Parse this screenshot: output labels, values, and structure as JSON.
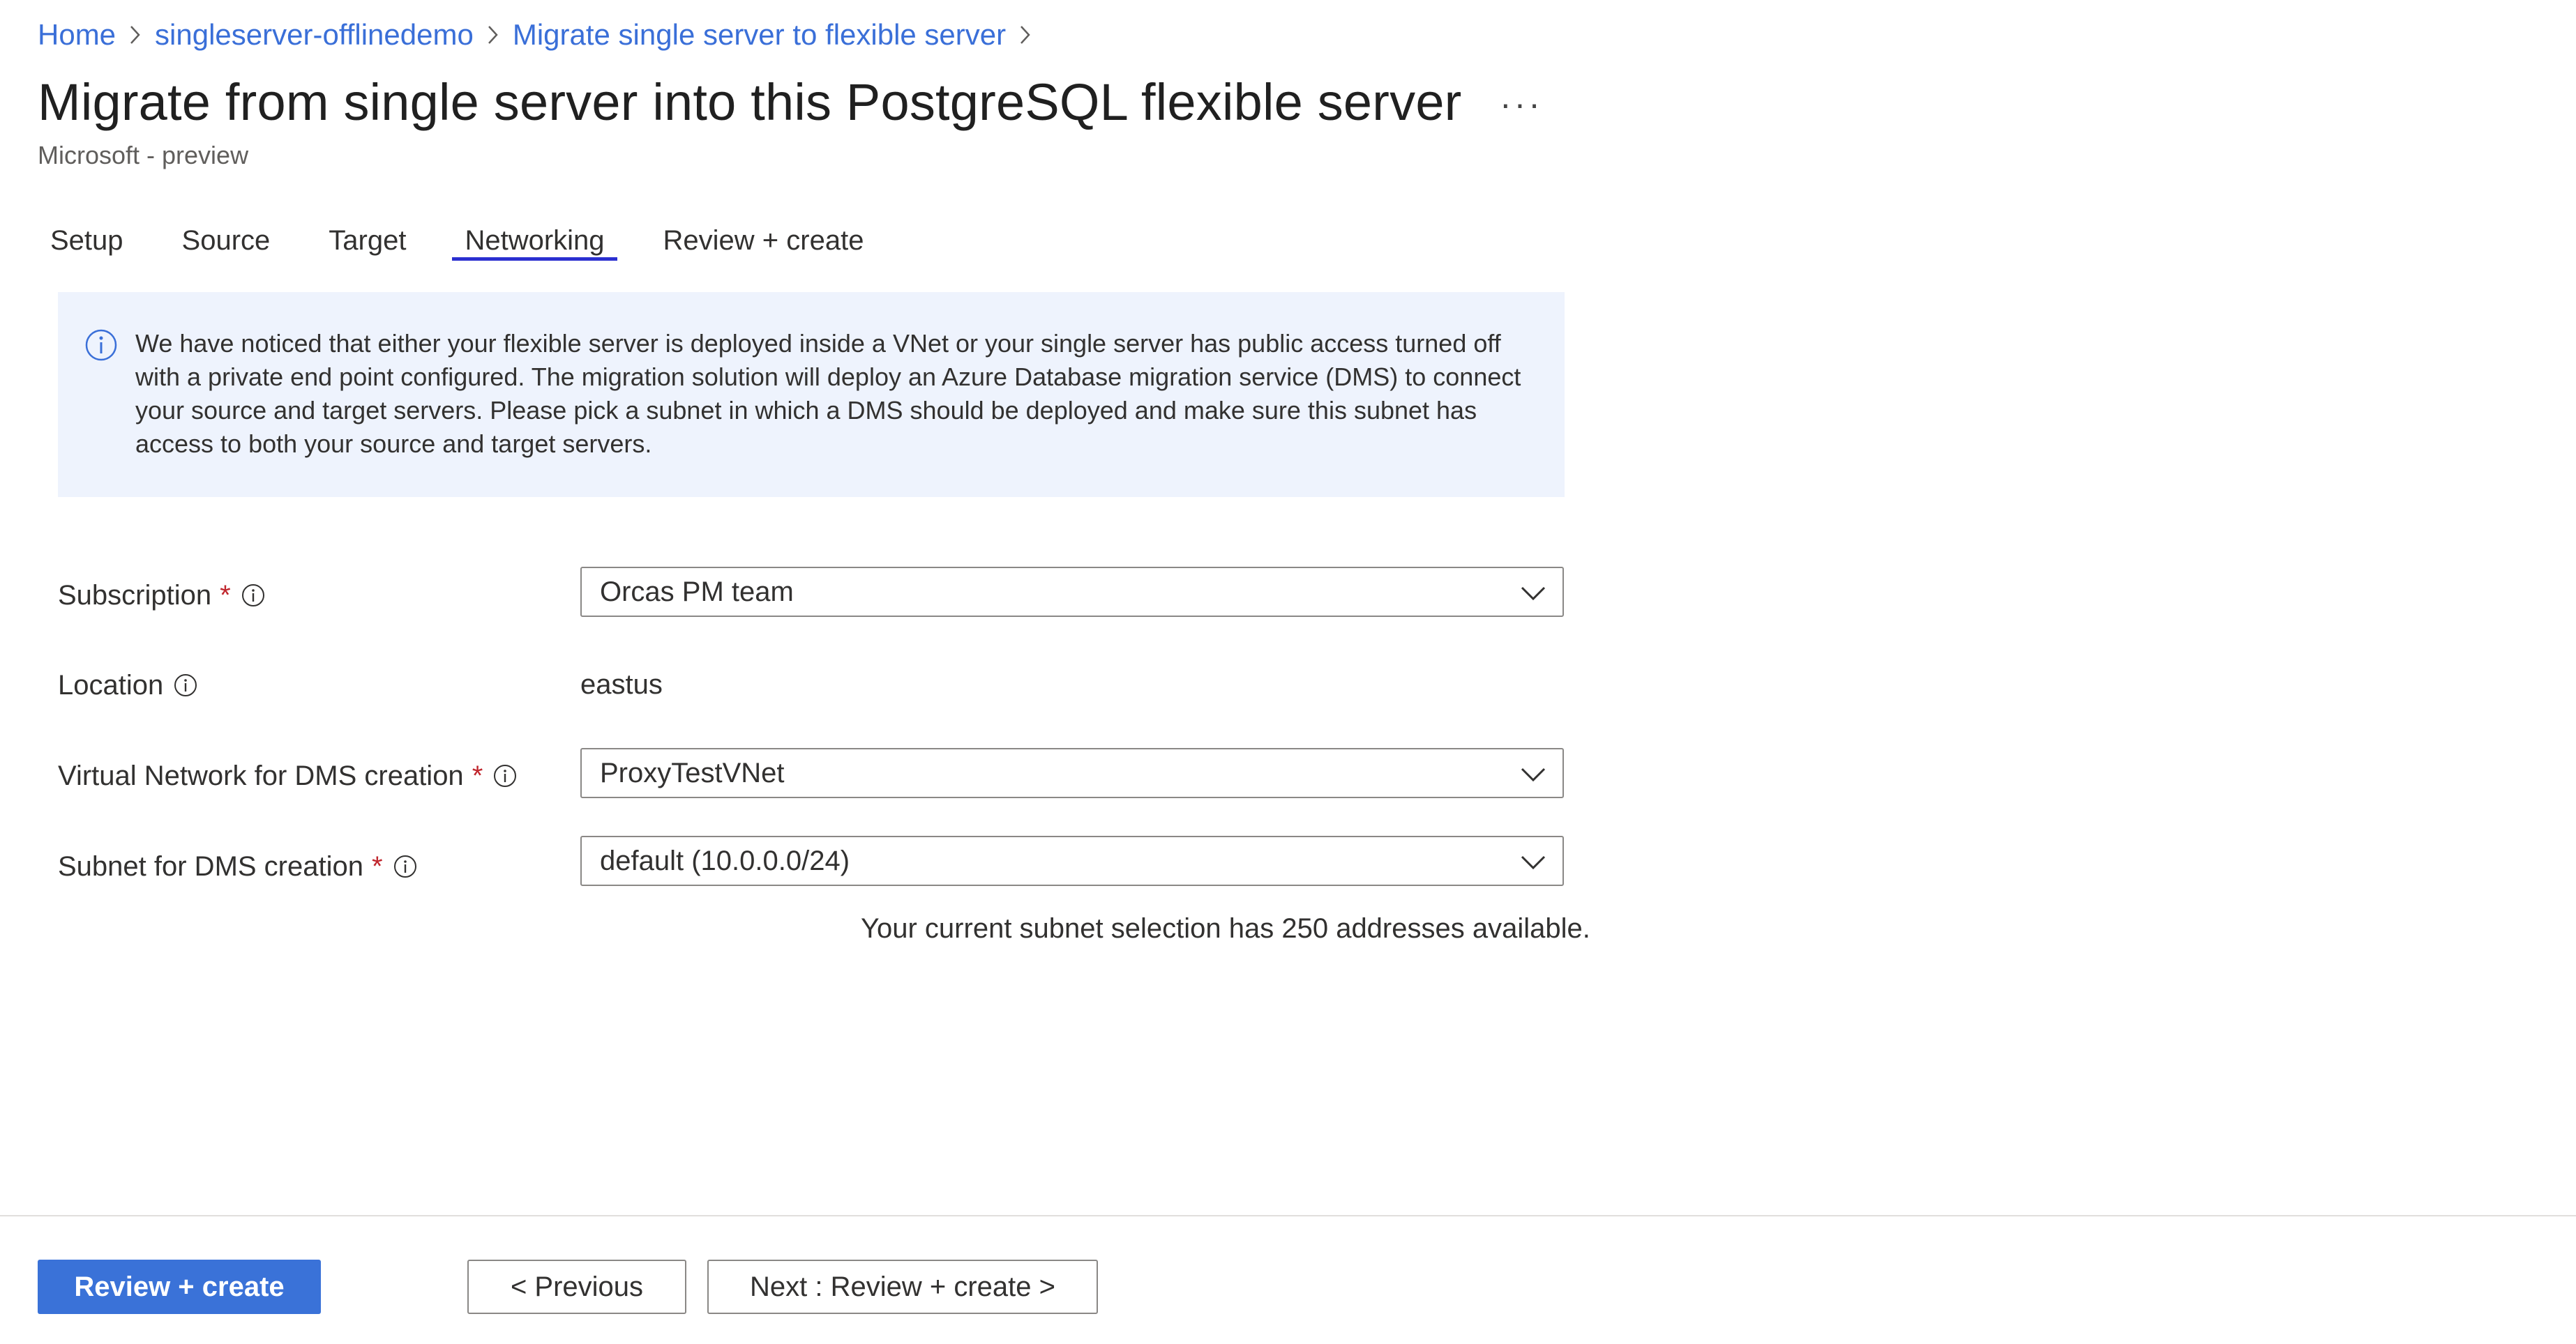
{
  "breadcrumb": {
    "items": [
      "Home",
      "singleserver-offlinedemo",
      "Migrate single server to flexible server"
    ]
  },
  "page": {
    "title": "Migrate from single server into this PostgreSQL flexible server",
    "subtitle": "Microsoft - preview",
    "more_label": "···"
  },
  "tabs": [
    {
      "label": "Setup",
      "active": false
    },
    {
      "label": "Source",
      "active": false
    },
    {
      "label": "Target",
      "active": false
    },
    {
      "label": "Networking",
      "active": true
    },
    {
      "label": "Review + create",
      "active": false
    }
  ],
  "banner": {
    "icon": "info-icon",
    "text": "We have noticed that either your flexible server is deployed inside a VNet or your single server has public access turned off with a private end point configured. The migration solution will deploy an Azure Database migration service (DMS) to connect your source and target servers. Please pick a subnet in which a DMS should be deployed and make sure this subnet has access to both your source and target servers."
  },
  "form": {
    "subscription": {
      "label": "Subscription",
      "required": "*",
      "value": "Orcas PM team"
    },
    "location": {
      "label": "Location",
      "value": "eastus"
    },
    "vnet": {
      "label": "Virtual Network for DMS creation",
      "required": "*",
      "value": "ProxyTestVNet"
    },
    "subnet": {
      "label": "Subnet for DMS creation",
      "required": "*",
      "value": "default (10.0.0.0/24)"
    },
    "subnet_hint": "Your current subnet selection has 250 addresses available."
  },
  "footer": {
    "review_create": "Review + create",
    "previous": "< Previous",
    "next": "Next : Review + create >"
  },
  "colors": {
    "link": "#3a6fd8",
    "primary_button": "#3a72d8",
    "tab_underline": "#2b2fd0",
    "banner_bg": "#eef3fd",
    "required": "#c0262d"
  }
}
